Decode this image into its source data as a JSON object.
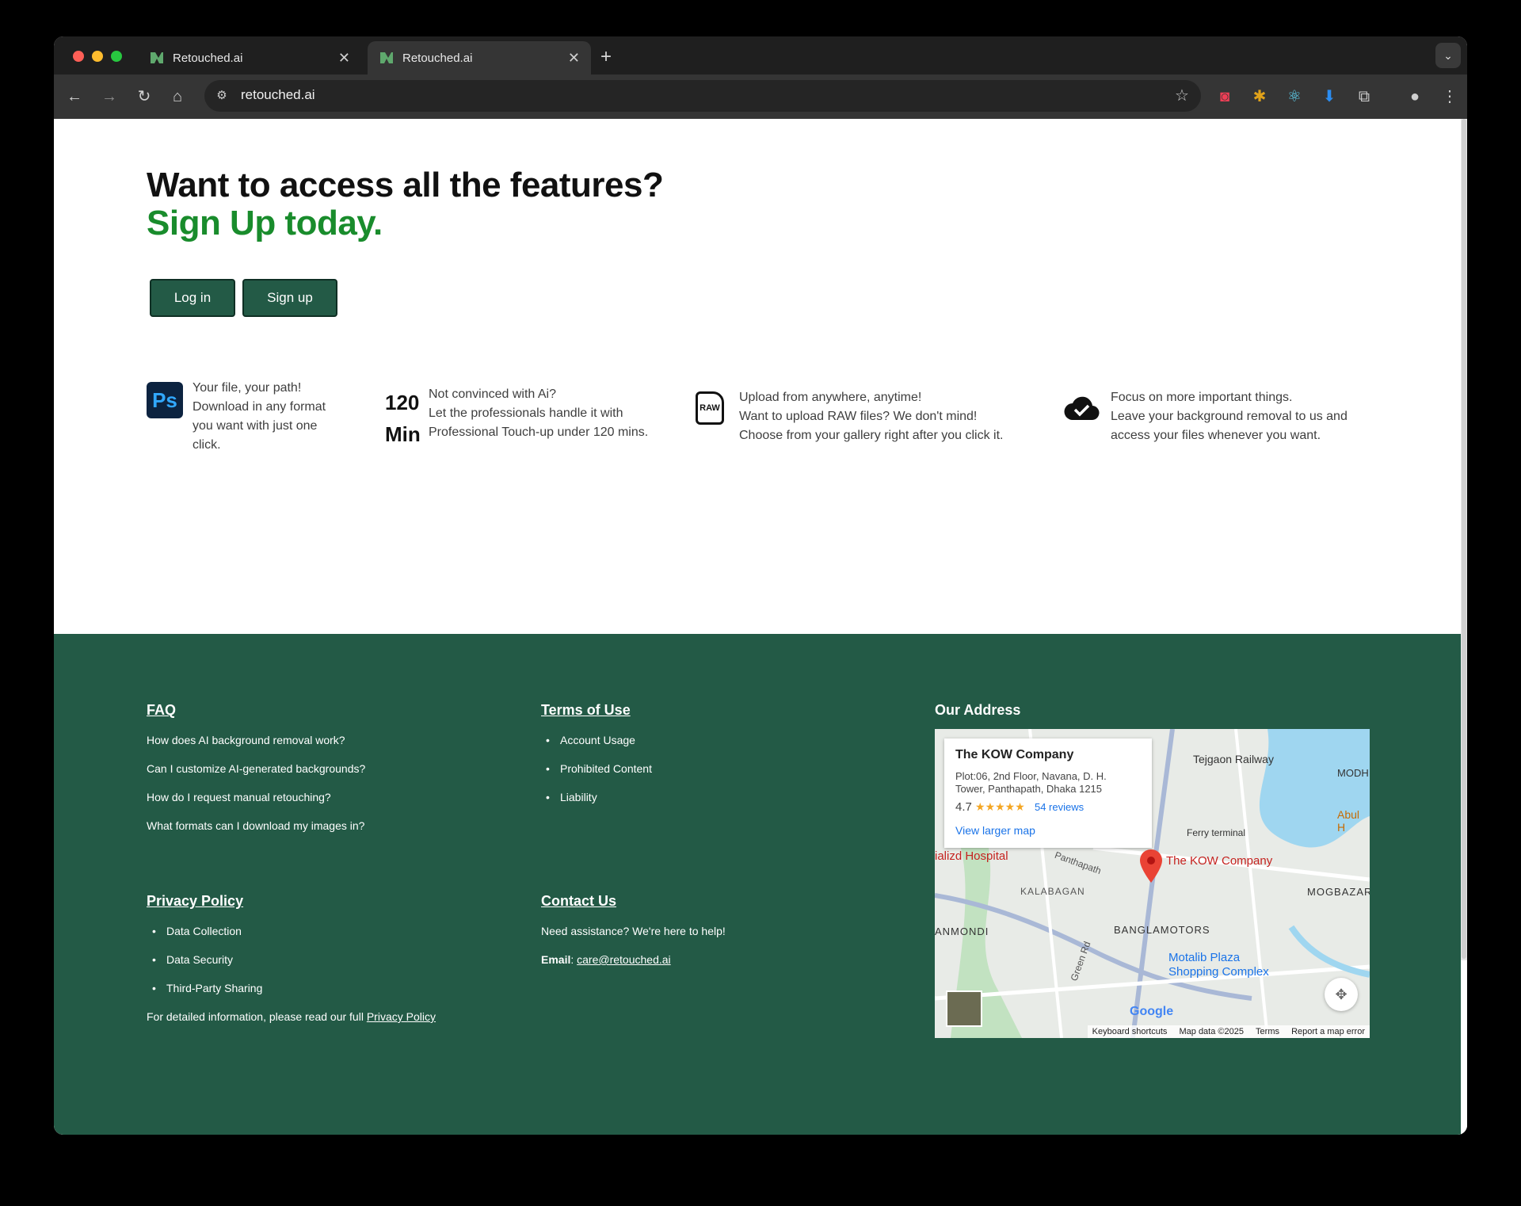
{
  "browser": {
    "tabs": [
      {
        "title": "Retouched.ai",
        "close": "✕"
      },
      {
        "title": "Retouched.ai",
        "close": "✕"
      }
    ],
    "new_tab": "+",
    "url": "retouched.ai"
  },
  "hero": {
    "title_line1": "Want to access all the features?",
    "title_line2": "Sign Up today.",
    "login_label": "Log in",
    "signup_label": "Sign up"
  },
  "features": [
    {
      "icon": "photoshop-icon",
      "icon_text": "Ps",
      "lines": [
        "Your file, your path!",
        "Download in any format",
        "you want with just one",
        "click."
      ]
    },
    {
      "icon_top": "120",
      "icon_bottom": "Min",
      "lines": [
        "Not convinced with Ai?",
        "Let the professionals handle it with",
        "Professional Touch-up under 120 mins."
      ]
    },
    {
      "icon": "raw-file-icon",
      "icon_text": "RAW",
      "lines": [
        "Upload from anywhere, anytime!",
        "Want to upload RAW files? We don't mind!",
        "Choose from your gallery right after you click it."
      ]
    },
    {
      "icon": "cloud-check-icon",
      "lines": [
        "Focus on more important things.",
        "Leave your background removal to us and",
        "access your files whenever you want."
      ]
    }
  ],
  "footer": {
    "faq": {
      "title": "FAQ",
      "items": [
        "How does AI background removal work?",
        "Can I customize AI-generated backgrounds?",
        "How do I request manual retouching?",
        "What formats can I download my images in?"
      ]
    },
    "terms": {
      "title": "Terms of Use",
      "items": [
        "Account Usage",
        "Prohibited Content",
        "Liability"
      ]
    },
    "privacy": {
      "title": "Privacy Policy",
      "items": [
        "Data Collection",
        "Data Security",
        "Third-Party Sharing"
      ],
      "note": "For detailed information, please read our full",
      "note_link": "Privacy Policy"
    },
    "contact": {
      "title": "Contact Us",
      "text": "Need assistance? We're here to help!",
      "email_label": "Email",
      "email": "care@retouched.ai"
    },
    "address": {
      "title": "Our Address",
      "place_name": "The KOW Company",
      "address_line1": "Plot:06, 2nd Floor, Navana, D. H.",
      "address_line2": "Tower, Panthapath, Dhaka 1215",
      "rating": "4.7",
      "stars": "★★★★★",
      "reviews": "54 reviews",
      "larger_map": "View larger map",
      "map_labels": [
        "Tejgaon Railway",
        "Ferry terminal",
        "ializd Hospital",
        "Panthapath",
        "The KOW Company",
        "KALABAGAN",
        "BANGLAMOTORS",
        "MOGBAZAR",
        "ANMONDI",
        "Green Rd",
        "Motalib Plaza",
        "Shopping Complex",
        "Abul H",
        "MODH"
      ],
      "attribution": [
        "Keyboard shortcuts",
        "Map data ©2025",
        "Terms",
        "Report a map error"
      ],
      "google": "Google"
    }
  },
  "colors": {
    "accent": "#198c2c",
    "footer_bg": "#235a46",
    "button_bg": "#235a46"
  }
}
